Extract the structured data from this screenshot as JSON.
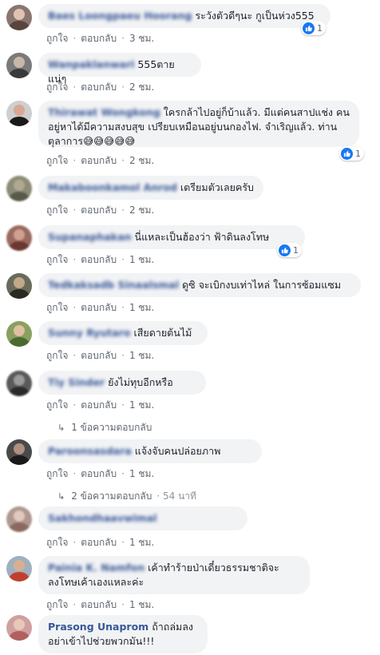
{
  "actions": {
    "like": "ถูกใจ",
    "reply": "ตอบกลับ"
  },
  "comments": [
    {
      "name": "Baes Loongpaeu Hoorang",
      "text": "ระวังตัวดีๆนะ กูเป็นห่วง555",
      "time": "3 ชม.",
      "reactions": "1"
    },
    {
      "name": "Wanpaklanwari",
      "text": "555ตายแน่ๆ",
      "time": "2 ชม.",
      "reactions": ""
    },
    {
      "name": "Thirawat Wongkong",
      "text": "ใครกล้าไปอยู่ก็บ้าแล้ว. มีแต่คนสาปแช่ง คนอยู่หาได้มีความสงบสุข เปรียบเหมือนอยู่บนกองไฟ. จำเริญแล้ว. ท่านตุลาการ😅😅😅😅😅",
      "time": "2 ชม.",
      "reactions": "1"
    },
    {
      "name": "Makaboonkamol Anrod",
      "text": "เตรียมตัวเลยครับ",
      "time": "2 ชม.",
      "reactions": ""
    },
    {
      "name": "Supanaphakan",
      "text": "นี่แหละเป็นฮ้องว่า ฟ้าดินลงโทษ",
      "time": "1 ชม.",
      "reactions": "1"
    },
    {
      "name": "Tedkaksadb Sinaalsmal",
      "text": "ดูซิ จะเบิกงบเท่าไหล่ ในการซ้อมแซม",
      "time": "1 ชม.",
      "reactions": ""
    },
    {
      "name": "Sunny Ryutaro",
      "text": "เสียดายต้นไม้",
      "time": "1 ชม.",
      "reactions": ""
    },
    {
      "name": "Tiy Sinder",
      "text": "ยังไม่ทุบอีกหรือ",
      "time": "1 ชม.",
      "reactions": "",
      "replies": "1 ข้อความตอบกลับ",
      "replies_time": ""
    },
    {
      "name": "Paroonsasdara",
      "text": "แจ้งจับคนปล่อยภาพ",
      "time": "1 ชม.",
      "reactions": "",
      "replies": "2 ข้อความตอบกลับ",
      "replies_time": "54 นาที"
    },
    {
      "name": "Sakhondhaavwimal",
      "text": "",
      "time": "1 ชม.",
      "reactions": ""
    },
    {
      "name": "Painia K. Namfon",
      "text": "เค้าทำร้ายป่าเดี๋ยวธรรมชาติจะลงโทษเค้าเองแหละค่ะ",
      "time": "1 ชม.",
      "reactions": ""
    },
    {
      "name": "Prasong Unaprom",
      "text": "ถ้าถล่มลง อย่าเข้าไปช่วยพวกมัน!!!",
      "time": "",
      "reactions": ""
    }
  ]
}
